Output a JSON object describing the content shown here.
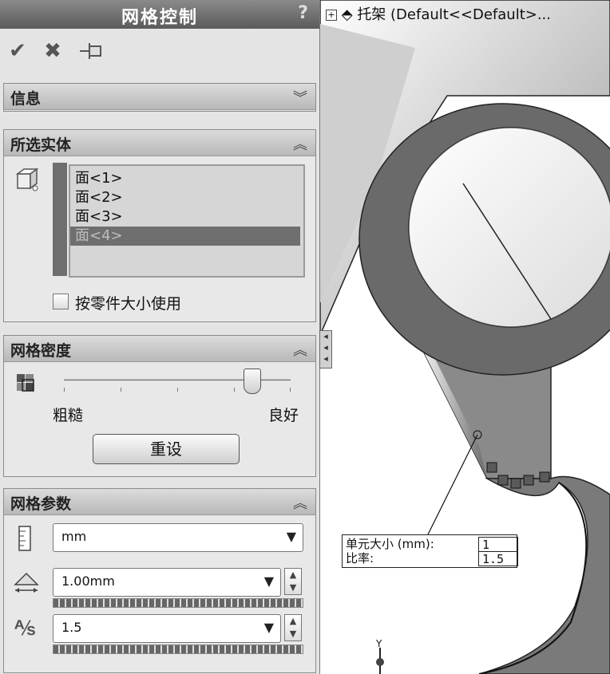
{
  "panel": {
    "title": "网格控制",
    "help": "?",
    "toolbar": {
      "ok_icon": "✔",
      "cancel_icon": "✖",
      "pin_icon": "⊣"
    }
  },
  "sections": {
    "info": {
      "label": "信息",
      "state": "collapsed"
    },
    "selected": {
      "label": "所选实体",
      "faces": [
        "面<1>",
        "面<2>",
        "面<3>",
        "面<4>"
      ],
      "selected_index": 3,
      "use_part_size_label": "按零件大小使用",
      "use_part_size_checked": false
    },
    "density": {
      "label": "网格密度",
      "coarse_label": "粗糙",
      "fine_label": "良好",
      "slider_value": 0.83,
      "reset_label": "重设"
    },
    "params": {
      "label": "网格参数",
      "unit_value": "mm",
      "size_value": "1.00mm",
      "ratio_value": "1.5"
    }
  },
  "viewport": {
    "tree_node_label": "托架  (Default<<Default>...",
    "callout": {
      "size_label": "单元大小 (mm):",
      "size_value": "1",
      "ratio_label": "比率:",
      "ratio_value": "1.5"
    },
    "triad_label": "Y"
  },
  "colors": {
    "title_bar": "#6e6e6e",
    "section_header": "#c4c4c4",
    "selection": "#6f6f6f"
  }
}
